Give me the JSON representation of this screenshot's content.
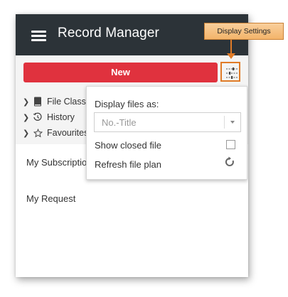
{
  "header": {
    "title": "Record Manager"
  },
  "toolbar": {
    "new_label": "New"
  },
  "tree": {
    "items": [
      {
        "label": "File Classi",
        "icon": "book-icon"
      },
      {
        "label": "History",
        "icon": "history-icon"
      },
      {
        "label": "Favourites",
        "icon": "star-icon"
      }
    ]
  },
  "menu": {
    "subscriptions": "My Subscriptio",
    "request": "My Request"
  },
  "popup": {
    "display_label": "Display files as:",
    "select_value": "No.-Title",
    "show_closed_label": "Show closed file",
    "refresh_label": "Refresh file plan"
  },
  "callout": {
    "label": "Display Settings"
  },
  "colors": {
    "header_bg": "#2c3338",
    "new_button": "#e0323e",
    "callout_accent": "#e07b27"
  }
}
